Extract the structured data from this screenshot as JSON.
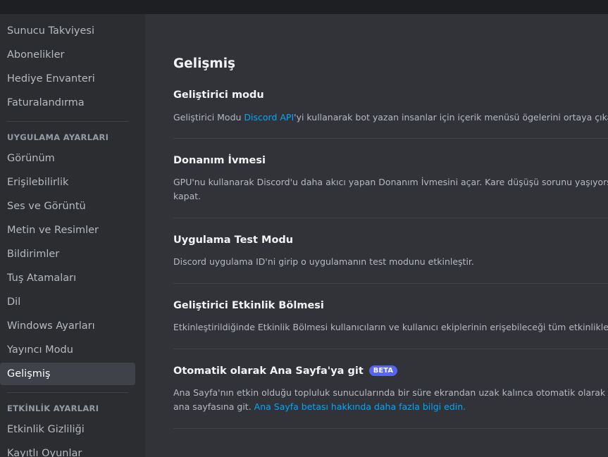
{
  "sidebar": {
    "items_top": [
      {
        "label": "Sunucu Takviyesi"
      },
      {
        "label": "Abonelikler"
      },
      {
        "label": "Hediye Envanteri"
      },
      {
        "label": "Faturalandırma"
      }
    ],
    "app_settings_header": "UYGULAMA AYARLARI",
    "app_items": [
      {
        "label": "Görünüm"
      },
      {
        "label": "Erişilebilirlik"
      },
      {
        "label": "Ses ve Görüntü"
      },
      {
        "label": "Metin ve Resimler"
      },
      {
        "label": "Bildirimler"
      },
      {
        "label": "Tuş Atamaları"
      },
      {
        "label": "Dil"
      },
      {
        "label": "Windows Ayarları"
      },
      {
        "label": "Yayıncı Modu"
      },
      {
        "label": "Gelişmiş",
        "active": true
      }
    ],
    "activity_settings_header": "ETKİNLİK AYARLARI",
    "activity_items": [
      {
        "label": "Etkinlik Gizliliği"
      },
      {
        "label": "Kayıtlı Oyunlar"
      }
    ]
  },
  "main": {
    "title": "Gelişmiş",
    "sections": [
      {
        "title": "Geliştirici modu",
        "desc_before": "Geliştirici Modu ",
        "desc_link": "Discord API",
        "desc_after": "'yi kullanarak bot yazan insanlar için içerik menüsü ögelerini ortaya çıkarır."
      },
      {
        "title": "Donanım İvmesi",
        "desc_line1": "GPU'nu kullanarak Discord'u daha akıcı yapan Donanım İvmesini açar. Kare düşüşü sorunu yaşıyorsan bunu",
        "desc_line2": "kapat."
      },
      {
        "title": "Uygulama Test Modu",
        "desc": "Discord uygulama ID'ni girip o uygulamanın test modunu etkinleştir."
      },
      {
        "title": "Geliştirici Etkinlik Bölmesi",
        "desc": "Etkinleştirildiğinde Etkinlik Bölmesi kullanıcıların ve kullanıcı ekiplerinin erişebileceği tüm etkinlikleri göster."
      },
      {
        "title": "Otomatik olarak Ana Sayfa'ya git",
        "badge": "BETA",
        "desc_line1": "Ana Sayfa'nın etkin olduğu topluluk sunucularında bir süre ekrandan uzak kalınca otomatik olarak sunucunun",
        "desc_line2_before": "ana sayfasına git. ",
        "desc_line2_link": "Ana Sayfa betası hakkında daha fazla bilgi edin."
      }
    ]
  },
  "colors": {
    "background": "#313338",
    "sidebar": "#2b2d31",
    "topbar": "#1e1f22",
    "link": "#00a8fc",
    "beta_badge": "#5865f2"
  }
}
